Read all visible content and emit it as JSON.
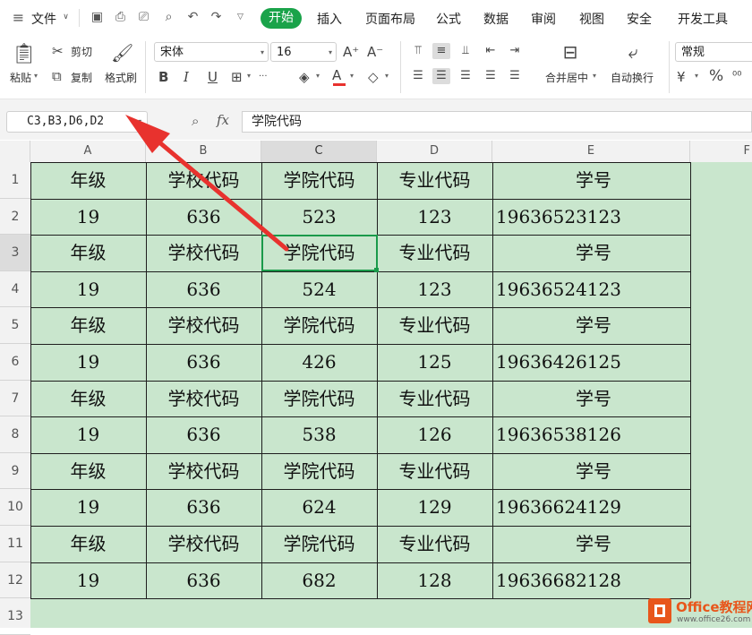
{
  "menu": {
    "file": "文件",
    "tabs": [
      "开始",
      "插入",
      "页面布局",
      "公式",
      "数据",
      "审阅",
      "视图",
      "安全",
      "开发工具"
    ],
    "active_tab": "开始"
  },
  "ribbon": {
    "paste": "粘贴",
    "cut": "剪切",
    "copy": "复制",
    "format_painter": "格式刷",
    "font_name": "宋体",
    "font_size": "16",
    "merge_center": "合并居中",
    "wrap_text": "自动换行",
    "number_format": "常规",
    "bold": "B",
    "italic": "I",
    "underline": "U",
    "font_color_glyph": "A",
    "percent": "%",
    "fx": "fx"
  },
  "formula_bar": {
    "name_box": "C3,B3,D6,D2",
    "formula": "学院代码"
  },
  "sheet": {
    "columns": [
      "A",
      "B",
      "C",
      "D",
      "E",
      "F"
    ],
    "rows": [
      "1",
      "2",
      "3",
      "4",
      "5",
      "6",
      "7",
      "8",
      "9",
      "10",
      "11",
      "12",
      "13"
    ],
    "cells": [
      [
        "年级",
        "学校代码",
        "学院代码",
        "专业代码",
        "学号"
      ],
      [
        "19",
        "636",
        "523",
        "123",
        "19636523123"
      ],
      [
        "年级",
        "学校代码",
        "学院代码",
        "专业代码",
        "学号"
      ],
      [
        "19",
        "636",
        "524",
        "123",
        "19636524123"
      ],
      [
        "年级",
        "学校代码",
        "学院代码",
        "专业代码",
        "学号"
      ],
      [
        "19",
        "636",
        "426",
        "125",
        "19636426125"
      ],
      [
        "年级",
        "学校代码",
        "学院代码",
        "专业代码",
        "学号"
      ],
      [
        "19",
        "636",
        "538",
        "126",
        "19636538126"
      ],
      [
        "年级",
        "学校代码",
        "学院代码",
        "专业代码",
        "学号"
      ],
      [
        "19",
        "636",
        "624",
        "129",
        "19636624129"
      ],
      [
        "年级",
        "学校代码",
        "学院代码",
        "专业代码",
        "学号"
      ],
      [
        "19",
        "636",
        "682",
        "128",
        "19636682128"
      ]
    ],
    "selected_cell": "C3",
    "fill_color": "#c9e6cd",
    "selection_color": "#1a9a4a"
  },
  "annotation": {
    "color": "#e8322e"
  },
  "watermark": {
    "title": "Office教程网",
    "url": "www.office26.com"
  }
}
